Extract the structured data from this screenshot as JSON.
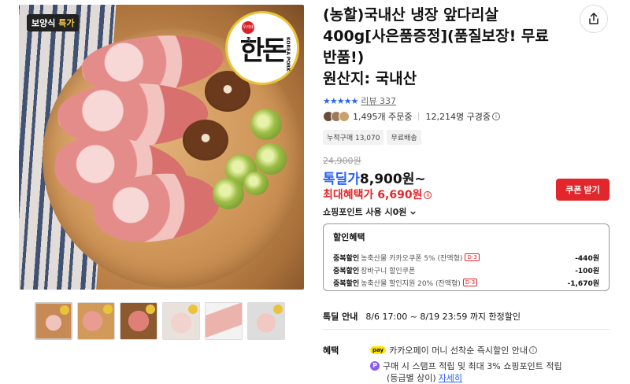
{
  "image": {
    "badge_prefix": "보양식",
    "badge_highlight": "특가",
    "brand_mark": "우리돼지",
    "brand_name": "한돈",
    "brand_sub": "KOREA PORK"
  },
  "product": {
    "title": "(농할)국내산 냉장 앞다리살 400g[사은품증정](품질보장! 무료반품!)",
    "origin": "원산지: 국내산"
  },
  "rating": {
    "stars": "★★★★★",
    "review_label": "리뷰 337"
  },
  "buyers": {
    "orders": "1,495개 주문중",
    "subscribers": "12,214명 구경중"
  },
  "chips": [
    "누적구매 13,070",
    "무료배송"
  ],
  "price": {
    "original": "24,900원",
    "deal_label": "톡딜가",
    "deal_value": "8,900원~",
    "max_benefit": "최대혜택가 6,690원"
  },
  "coupon_button": "쿠폰 받기",
  "points": "쇼핑포인트 사용 시0원",
  "discounts": {
    "title": "할인혜택",
    "rows": [
      {
        "kind": "중복할인",
        "desc": "농축산물 카카오쿠폰 5% (잔액형)",
        "dday": "D-3",
        "amount": "-440원"
      },
      {
        "kind": "중복할인",
        "desc": "장바구니 할인쿠폰",
        "dday": "",
        "amount": "-100원"
      },
      {
        "kind": "중복할인",
        "desc": "농축산물 할인지원 20% (잔액형)",
        "dday": "D-3",
        "amount": "-1,670원"
      }
    ]
  },
  "deal_info": {
    "label": "톡딜 안내",
    "period": "8/6 17:00 ~ 8/19 23:59 까지 한정할인"
  },
  "benefits": {
    "label": "혜택",
    "pay_badge": "pay",
    "kakaopay": "카카오페이 머니 선착순 즉시할인 안내",
    "point_badge": "P",
    "stamp": "구매 시 스탬프 적립 및 최대 3% 쇼핑포인트 적립",
    "grade": "(등급별 상이)",
    "detail": "자세히"
  }
}
